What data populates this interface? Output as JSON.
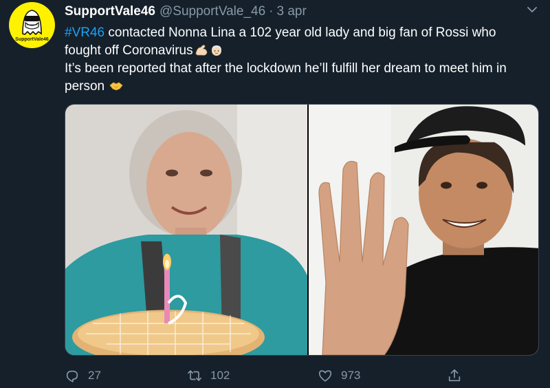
{
  "tweet": {
    "author": {
      "display_name": "SupportVale46",
      "handle": "@SupportVale_46",
      "separator": "·",
      "date": "3 apr",
      "avatar_label": "SupportVale46"
    },
    "text": {
      "hashtag": "#VR46",
      "line1_rest": " contacted Nonna Lina a 102 year old lady and big fan of Rossi who fought off Coronavirus",
      "line2": "It’s been reported that after the lockdown he’ll fulfill her dream to meet him in person"
    },
    "emoji": [
      "flexed-biceps-emoji",
      "older-woman-emoji",
      "handshake-emoji"
    ],
    "actions": {
      "replies": "27",
      "retweets": "102",
      "likes": "973"
    }
  },
  "colors": {
    "background": "#15202b",
    "hashtag": "#1da1f2",
    "secondary_text": "#8899a6",
    "avatar_bg": "#fff200"
  }
}
